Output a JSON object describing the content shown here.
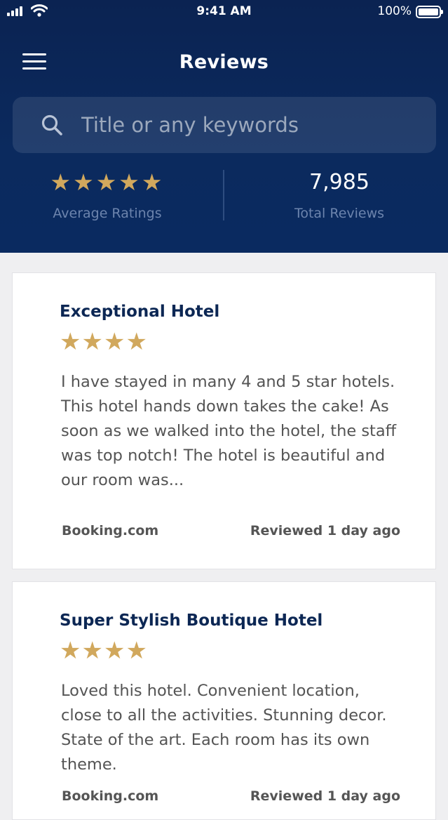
{
  "status_bar": {
    "time": "9:41 AM",
    "battery": "100%"
  },
  "header": {
    "title": "Reviews",
    "search_placeholder": "Title or any keywords"
  },
  "summary": {
    "average_stars": "★★★★★",
    "average_label": "Average Ratings",
    "total_value": "7,985",
    "total_label": "Total Reviews"
  },
  "reviews": [
    {
      "title": "Exceptional Hotel",
      "rating": 4,
      "stars": "★★★★",
      "body": "I have stayed in many 4 and 5 star hotels. This hotel hands down takes the cake! As soon as we walked into the hotel, the staff was top notch! The hotel is beautiful and our room was...",
      "source": "Booking.com",
      "date": "Reviewed 1 day ago"
    },
    {
      "title": "Super Stylish Boutique Hotel",
      "rating": 4,
      "stars": "★★★★",
      "body": "Loved this hotel. Convenient location, close to all the activities. Stunning decor. State of the art. Each room has its own theme.",
      "source": "Booking.com",
      "date": "Reviewed 1 day ago"
    }
  ],
  "colors": {
    "header_bg": "#0b2a5e",
    "star": "#d1a85d",
    "title_text": "#0c2754",
    "muted_label": "#6c84ad"
  },
  "icons": [
    "signal-icon",
    "wifi-icon",
    "battery-icon",
    "menu-icon",
    "search-icon",
    "star-icon"
  ]
}
